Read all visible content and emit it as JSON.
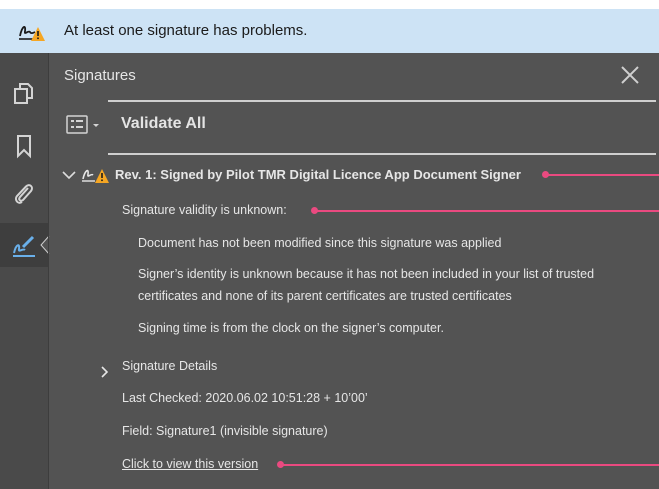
{
  "banner": {
    "text": "At least one signature has problems.",
    "icon": "signature-warning-icon"
  },
  "sidebar": {
    "items": [
      {
        "icon": "copy-pages-icon"
      },
      {
        "icon": "bookmark-icon"
      },
      {
        "icon": "paperclip-icon"
      },
      {
        "icon": "signature-pen-icon",
        "active": true
      }
    ]
  },
  "panel": {
    "title": "Signatures",
    "close_icon": "close-icon",
    "options_icon": "options-menu-icon",
    "validate_all": "Validate All"
  },
  "signature": {
    "revision": "Rev. 1:  Signed by Pilot TMR Digital Licence App Document Signer",
    "validity": "Signature validity is unknown:",
    "not_modified": "Document has not been modified since this signature was applied",
    "identity_line1": "Signer’s identity is unknown because it has not been included in your list of trusted",
    "identity_line2": "certificates and none of its parent certificates are trusted certificates",
    "signing_time": "Signing time is from the clock on the signer’s computer.",
    "details": "Signature Details",
    "last_checked": "Last Checked: 2020.06.02 10:51:28 + 10’00’",
    "field": "Field: Signature1 (invisible signature)",
    "view_version": "Click to view this version"
  },
  "colors": {
    "banner_bg": "#cde3f5",
    "panel_bg": "#535353",
    "leader": "#ea4a80",
    "warning": "#f5a623"
  }
}
